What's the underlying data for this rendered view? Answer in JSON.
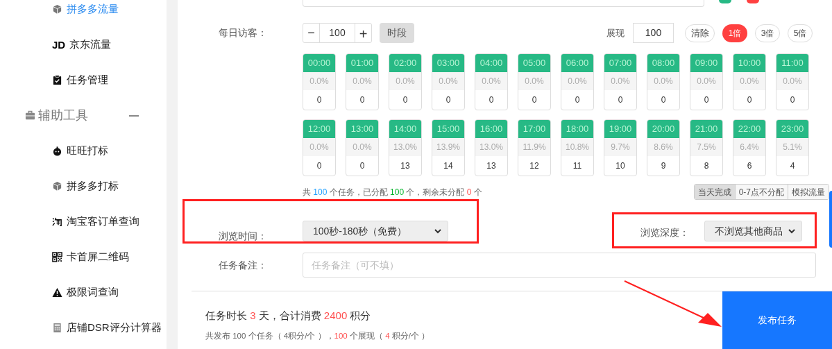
{
  "sidebar": {
    "items": [
      {
        "kind": "item",
        "label": "拼多多流量",
        "selected": true
      },
      {
        "kind": "item",
        "label": "京东流量",
        "selected": false
      },
      {
        "kind": "item",
        "label": "任务管理",
        "selected": false
      },
      {
        "kind": "section",
        "label": "辅助工具",
        "expanded": true
      },
      {
        "kind": "item",
        "label": "旺旺打标",
        "selected": false
      },
      {
        "kind": "item",
        "label": "拼多多打标",
        "selected": false
      },
      {
        "kind": "item",
        "label": "淘宝客订单查询",
        "selected": false
      },
      {
        "kind": "item",
        "label": "卡首屏二维码",
        "selected": false
      },
      {
        "kind": "item",
        "label": "极限词查询",
        "selected": false
      },
      {
        "kind": "item",
        "label": "店铺DSR评分计算器",
        "selected": false
      }
    ]
  },
  "jd_icon_text": "JD",
  "daily_visitors": {
    "label": "每日访客：",
    "minus": "−",
    "value": "100",
    "plus": "+",
    "period_button": "时段",
    "display_label": "展现",
    "display_value": "100",
    "clear_button": "清除",
    "multipliers": [
      {
        "label": "1倍",
        "selected": true
      },
      {
        "label": "3倍",
        "selected": false
      },
      {
        "label": "5倍",
        "selected": false
      }
    ]
  },
  "hours": [
    {
      "time": "00:00",
      "percent": "0.0%",
      "count": "0"
    },
    {
      "time": "01:00",
      "percent": "0.0%",
      "count": "0"
    },
    {
      "time": "02:00",
      "percent": "0.0%",
      "count": "0"
    },
    {
      "time": "03:00",
      "percent": "0.0%",
      "count": "0"
    },
    {
      "time": "04:00",
      "percent": "0.0%",
      "count": "0"
    },
    {
      "time": "05:00",
      "percent": "0.0%",
      "count": "0"
    },
    {
      "time": "06:00",
      "percent": "0.0%",
      "count": "0"
    },
    {
      "time": "07:00",
      "percent": "0.0%",
      "count": "0"
    },
    {
      "time": "08:00",
      "percent": "0.0%",
      "count": "0"
    },
    {
      "time": "09:00",
      "percent": "0.0%",
      "count": "0"
    },
    {
      "time": "10:00",
      "percent": "0.0%",
      "count": "0"
    },
    {
      "time": "11:00",
      "percent": "0.0%",
      "count": "0"
    },
    {
      "time": "12:00",
      "percent": "0.0%",
      "count": "0"
    },
    {
      "time": "13:00",
      "percent": "0.0%",
      "count": "0"
    },
    {
      "time": "14:00",
      "percent": "13.0%",
      "count": "13"
    },
    {
      "time": "15:00",
      "percent": "13.9%",
      "count": "14"
    },
    {
      "time": "16:00",
      "percent": "13.0%",
      "count": "13"
    },
    {
      "time": "17:00",
      "percent": "11.9%",
      "count": "12"
    },
    {
      "time": "18:00",
      "percent": "10.8%",
      "count": "11"
    },
    {
      "time": "19:00",
      "percent": "9.7%",
      "count": "10"
    },
    {
      "time": "20:00",
      "percent": "8.6%",
      "count": "9"
    },
    {
      "time": "21:00",
      "percent": "7.5%",
      "count": "8"
    },
    {
      "time": "22:00",
      "percent": "6.4%",
      "count": "6"
    },
    {
      "time": "23:00",
      "percent": "5.1%",
      "count": "4"
    }
  ],
  "allocation_summary": [
    {
      "text": "共 ",
      "kind": "plain"
    },
    {
      "text": "100",
      "kind": "info"
    },
    {
      "text": " 个任务，已分配 ",
      "kind": "plain"
    },
    {
      "text": "100",
      "kind": "success"
    },
    {
      "text": " 个，剩余未分配 ",
      "kind": "plain"
    },
    {
      "text": "0",
      "kind": "danger"
    },
    {
      "text": " 个",
      "kind": "plain"
    }
  ],
  "modes": [
    {
      "label": "当天完成",
      "selected": true
    },
    {
      "label": "0-7点不分配",
      "selected": false
    },
    {
      "label": "模拟流量",
      "selected": false
    }
  ],
  "browse_time": {
    "label": "浏览时间：",
    "value": "100秒-180秒（免费）"
  },
  "browse_depth": {
    "label": "浏览深度：",
    "value": "不浏览其他商品"
  },
  "remarks": {
    "label": "任务备注：",
    "placeholder": "任务备注（可不填）"
  },
  "cost_summary": [
    {
      "text": "任务时长 ",
      "kind": "plain"
    },
    {
      "text": "3",
      "kind": "danger"
    },
    {
      "text": " 天，合计消费 ",
      "kind": "plain"
    },
    {
      "text": "2400",
      "kind": "danger"
    },
    {
      "text": " 积分",
      "kind": "plain"
    }
  ],
  "cost_detail": [
    {
      "text": "共发布 100 个任务（ 4积分/个 ），",
      "kind": "plain"
    },
    {
      "text": "100",
      "kind": "danger"
    },
    {
      "text": " 个展现（ ",
      "kind": "plain"
    },
    {
      "text": "4",
      "kind": "danger"
    },
    {
      "text": " 积分/个 ）",
      "kind": "plain"
    }
  ],
  "publish_button": "发布任务"
}
